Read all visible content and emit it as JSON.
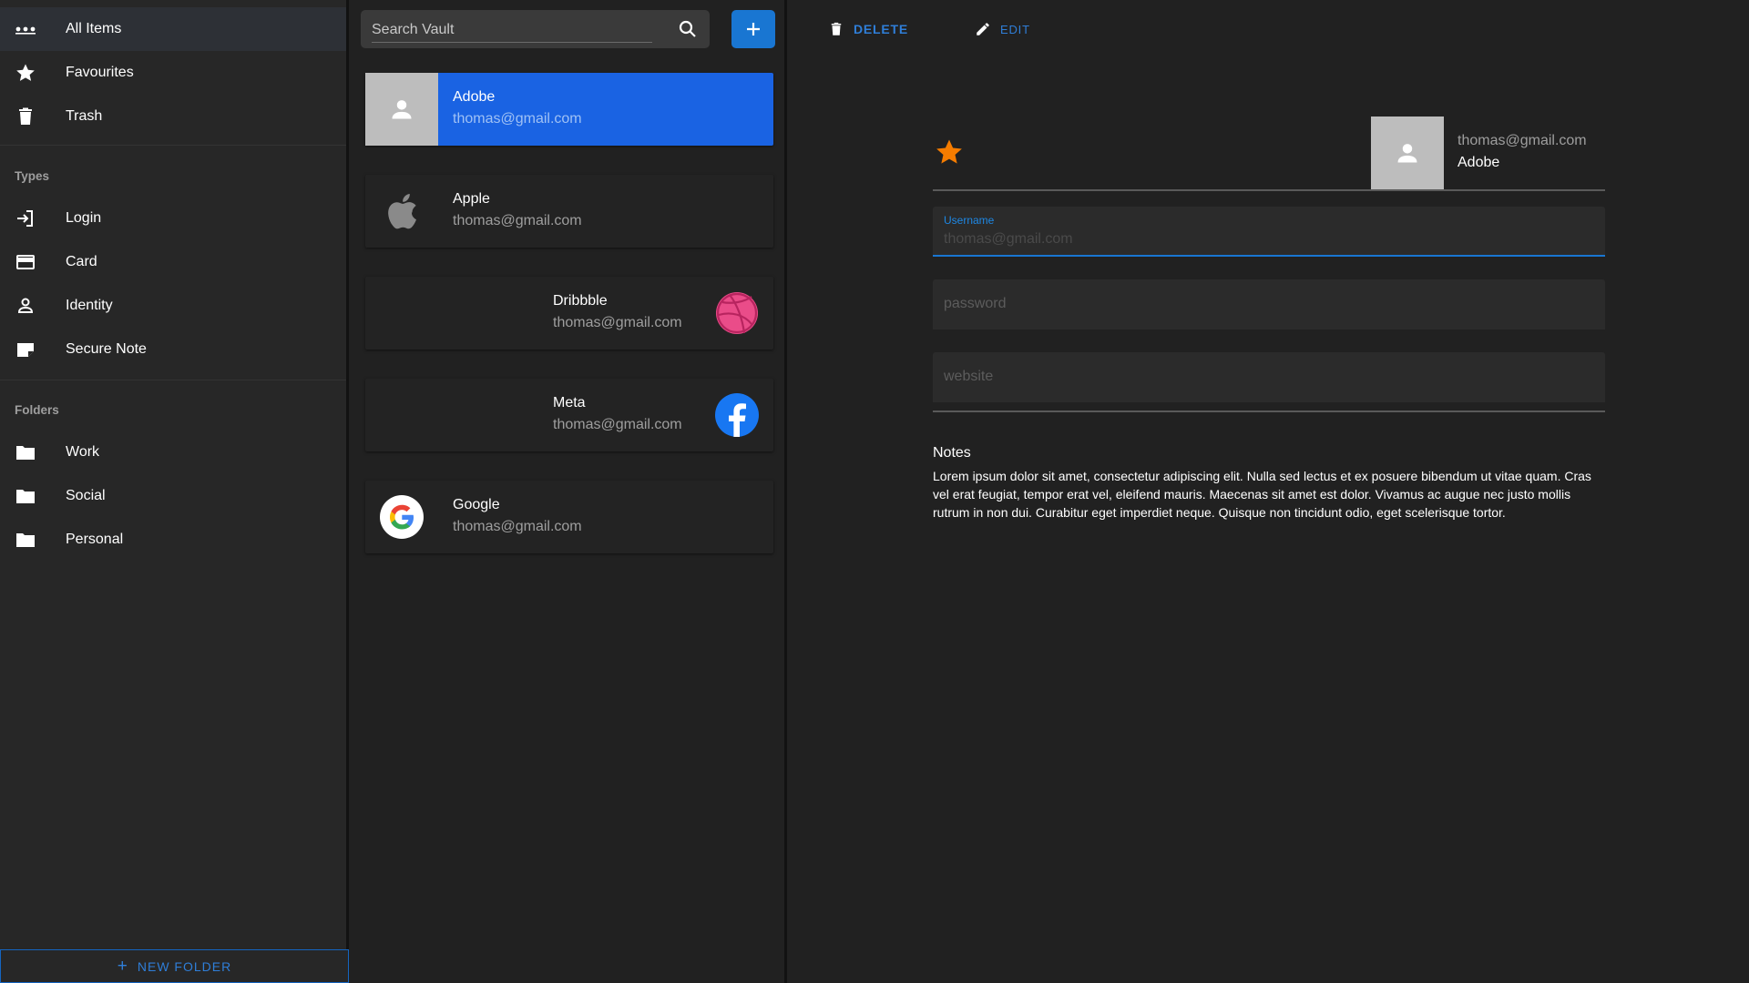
{
  "sidebar": {
    "main_items": [
      {
        "label": "All Items",
        "icon": "more-dots-icon"
      },
      {
        "label": "Favourites",
        "icon": "star-icon"
      },
      {
        "label": "Trash",
        "icon": "trash-icon"
      }
    ],
    "types_title": "Types",
    "types": [
      {
        "label": "Login",
        "icon": "login-icon"
      },
      {
        "label": "Card",
        "icon": "credit-card-icon"
      },
      {
        "label": "Identity",
        "icon": "person-icon"
      },
      {
        "label": "Secure Note",
        "icon": "note-icon"
      }
    ],
    "folders_title": "Folders",
    "folders": [
      {
        "label": "Work",
        "icon": "folder-icon"
      },
      {
        "label": "Social",
        "icon": "folder-icon"
      },
      {
        "label": "Personal",
        "icon": "folder-icon"
      }
    ],
    "new_folder_icon": "+",
    "new_folder_label": "NEW FOLDER"
  },
  "list": {
    "search_placeholder": "Search Vault",
    "add_button_icon": "+",
    "items": [
      {
        "title": "Adobe",
        "subtitle": "thomas@gmail.com",
        "logo": "person-placeholder-icon",
        "selected": true
      },
      {
        "title": "Apple",
        "subtitle": "thomas@gmail.com",
        "logo": "apple-logo-icon"
      },
      {
        "title": "Dribbble",
        "subtitle": "thomas@gmail.com",
        "logo": "dribbble-logo-icon"
      },
      {
        "title": "Meta",
        "subtitle": "thomas@gmail.com",
        "logo": "facebook-logo-icon"
      },
      {
        "title": "Google",
        "subtitle": "thomas@gmail.com",
        "logo": "google-logo-icon"
      }
    ]
  },
  "detail": {
    "delete_label": "DELETE",
    "edit_label": "EDIT",
    "favourite": true,
    "email": "thomas@gmail.com",
    "title": "Adobe",
    "username_label": "Username",
    "username_value": "thomas@gmail.com",
    "password_placeholder": "password",
    "website_placeholder": "website",
    "notes_title": "Notes",
    "notes_text": "Lorem ipsum dolor sit amet, consectetur adipiscing elit. Nulla sed lectus et ex posuere bibendum ut vitae quam. Cras vel erat feugiat, tempor erat vel, eleifend mauris. Maecenas sit amet est dolor. Vivamus ac augue nec justo mollis rutrum in non dui. Curabitur eget imperdiet neque. Quisque non tincidunt odio, eget scelerisque tortor."
  },
  "colors": {
    "accent": "#1976d2",
    "selected_card": "#1a63e3",
    "star": "#f57c00",
    "dribbble": "#ea4c89",
    "facebook": "#1877f2"
  }
}
